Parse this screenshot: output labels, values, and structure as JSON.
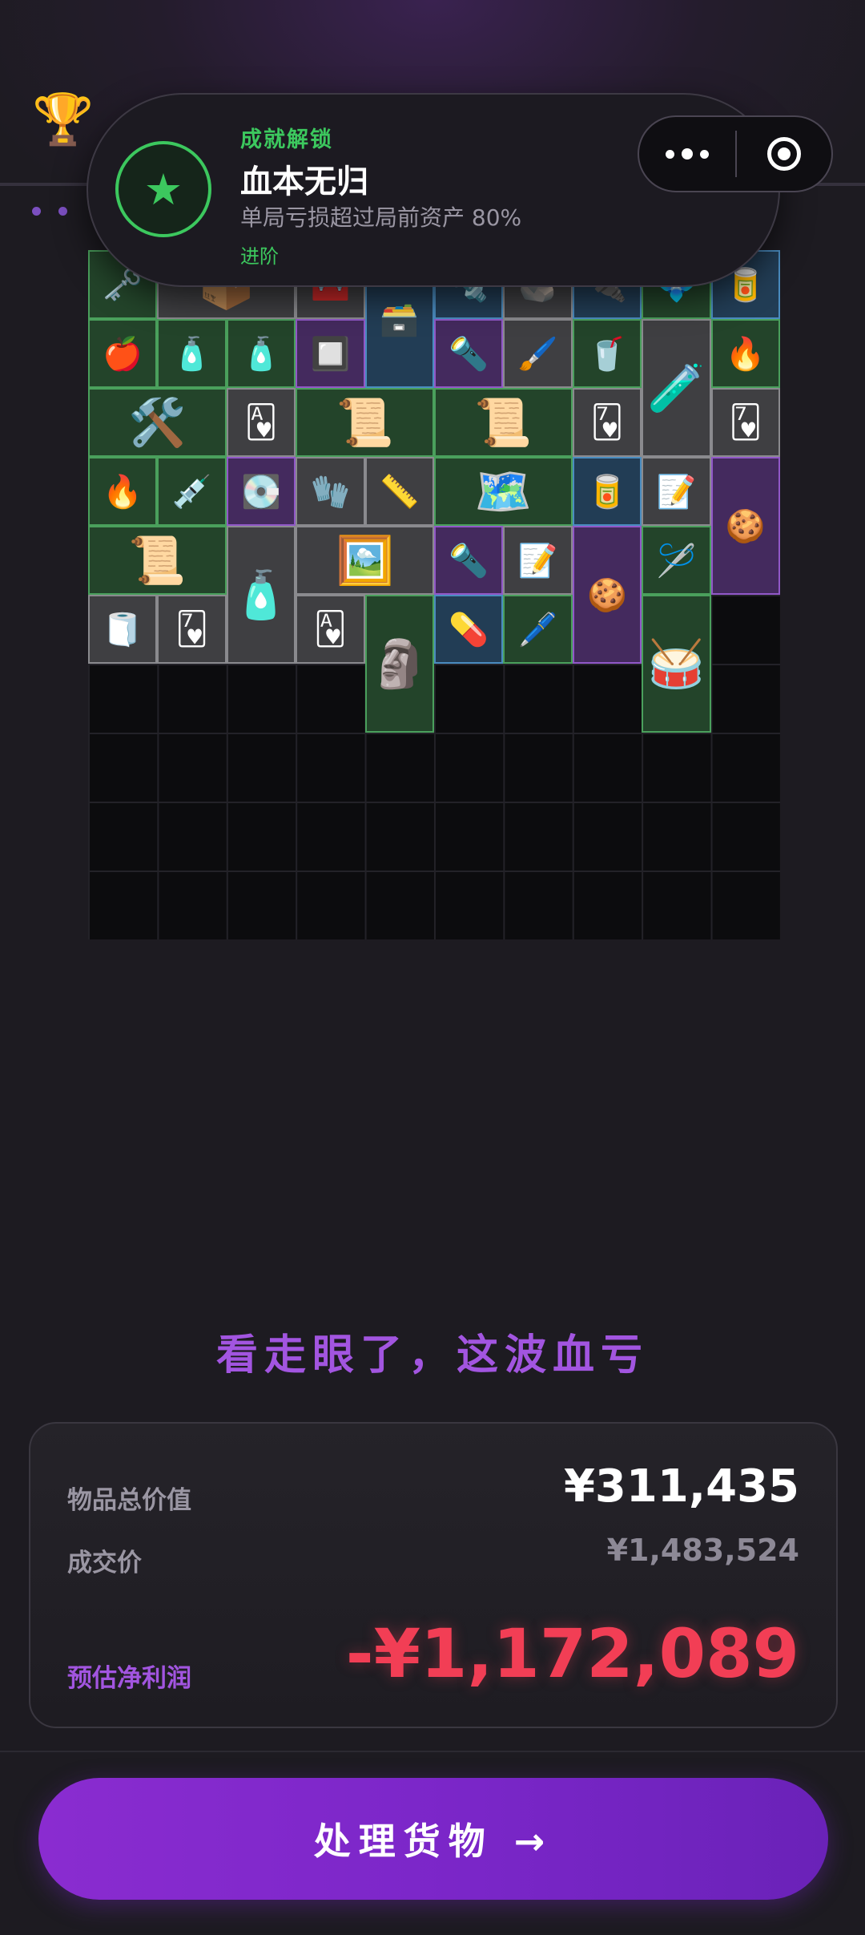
{
  "achievement": {
    "kicker": "成就解锁",
    "title": "血本无归",
    "description": "单局亏损超过局前资产 80%",
    "tier": "进阶",
    "icon": "star-icon",
    "accent": "#3cc85e"
  },
  "header": {
    "icon": "trophy-icon"
  },
  "menu_capsule": {
    "more_icon": "more-dots-icon",
    "close_icon": "target-close-icon"
  },
  "inventory": {
    "columns": 10,
    "rows": 10,
    "items": [
      {
        "name": "keychain",
        "icon": "🗝️",
        "rarity": "green"
      },
      {
        "name": "box-item",
        "icon": "📦",
        "rarity": "gray"
      },
      {
        "name": "crate-item",
        "icon": "🧰",
        "rarity": "gray"
      },
      {
        "name": "ammo-box",
        "icon": "🗃️",
        "rarity": "blue"
      },
      {
        "name": "metal-part",
        "icon": "🔩",
        "rarity": "blue"
      },
      {
        "name": "rock-item",
        "icon": "🪨",
        "rarity": "gray"
      },
      {
        "name": "socket-item",
        "icon": "🔌",
        "rarity": "blue"
      },
      {
        "name": "circuit-item",
        "icon": "💠",
        "rarity": "green"
      },
      {
        "name": "ration-box",
        "icon": "🥫",
        "rarity": "blue"
      },
      {
        "name": "apple",
        "icon": "🍎",
        "rarity": "green"
      },
      {
        "name": "iv-bag-1",
        "icon": "🧴",
        "rarity": "green"
      },
      {
        "name": "iv-bag-2",
        "icon": "🧴",
        "rarity": "green"
      },
      {
        "name": "circuit-board",
        "icon": "🔲",
        "rarity": "purple"
      },
      {
        "name": "flashlight-1",
        "icon": "🔦",
        "rarity": "purple"
      },
      {
        "name": "paintbrush",
        "icon": "🖌️",
        "rarity": "gray"
      },
      {
        "name": "energy-can",
        "icon": "🥤",
        "rarity": "green"
      },
      {
        "name": "medicine-bottle",
        "icon": "🧪",
        "rarity": "gray"
      },
      {
        "name": "lighter-1",
        "icon": "🔥",
        "rarity": "green"
      },
      {
        "name": "power-drill",
        "icon": "🛠️",
        "rarity": "green"
      },
      {
        "name": "playing-card-1",
        "icon": "🂱",
        "rarity": "gray"
      },
      {
        "name": "old-document-1",
        "icon": "📜",
        "rarity": "green"
      },
      {
        "name": "old-document-2",
        "icon": "📜",
        "rarity": "green"
      },
      {
        "name": "playing-card-2",
        "icon": "🂷",
        "rarity": "gray"
      },
      {
        "name": "playing-card-3",
        "icon": "🂷",
        "rarity": "gray"
      },
      {
        "name": "lighter-2",
        "icon": "🔥",
        "rarity": "green"
      },
      {
        "name": "syringe",
        "icon": "💉",
        "rarity": "green"
      },
      {
        "name": "hard-drive",
        "icon": "💽",
        "rarity": "purple"
      },
      {
        "name": "gloves",
        "icon": "🧤",
        "rarity": "gray"
      },
      {
        "name": "tape-measure",
        "icon": "📏",
        "rarity": "gray"
      },
      {
        "name": "map-scroll",
        "icon": "🗺️",
        "rarity": "green"
      },
      {
        "name": "ration-tin",
        "icon": "🥫",
        "rarity": "blue"
      },
      {
        "name": "note-paper-1",
        "icon": "📝",
        "rarity": "gray"
      },
      {
        "name": "gingerbread-1",
        "icon": "🍪",
        "rarity": "purple"
      },
      {
        "name": "old-document-3",
        "icon": "📜",
        "rarity": "green"
      },
      {
        "name": "toothpaste",
        "icon": "🧴",
        "rarity": "gray"
      },
      {
        "name": "old-photo",
        "icon": "🖼️",
        "rarity": "gray"
      },
      {
        "name": "flashlight-2",
        "icon": "🔦",
        "rarity": "purple"
      },
      {
        "name": "note-paper-2",
        "icon": "📝",
        "rarity": "gray"
      },
      {
        "name": "gingerbread-2",
        "icon": "🍪",
        "rarity": "purple"
      },
      {
        "name": "tweezers",
        "icon": "🪡",
        "rarity": "green"
      },
      {
        "name": "duct-tape",
        "icon": "🧻",
        "rarity": "gray"
      },
      {
        "name": "playing-card-4",
        "icon": "🂷",
        "rarity": "gray"
      },
      {
        "name": "playing-card-5",
        "icon": "🂱",
        "rarity": "gray"
      },
      {
        "name": "wooden-statue",
        "icon": "🗿",
        "rarity": "green"
      },
      {
        "name": "pill-bottle",
        "icon": "💊",
        "rarity": "blue"
      },
      {
        "name": "marker-pen",
        "icon": "🖊️",
        "rarity": "green"
      },
      {
        "name": "djembe-drum",
        "icon": "🥁",
        "rarity": "green"
      }
    ]
  },
  "verdict": "看走眼了，这波血亏",
  "summary": {
    "total_label": "物品总价值",
    "total_value": "¥311,435",
    "deal_label": "成交价",
    "deal_value": "¥1,483,524",
    "profit_label": "预估净利润",
    "profit_value": "-¥1,172,089",
    "profit_color": "#f23e55",
    "label_accent": "#a255e0"
  },
  "cta": {
    "label": "处理货物 →"
  }
}
